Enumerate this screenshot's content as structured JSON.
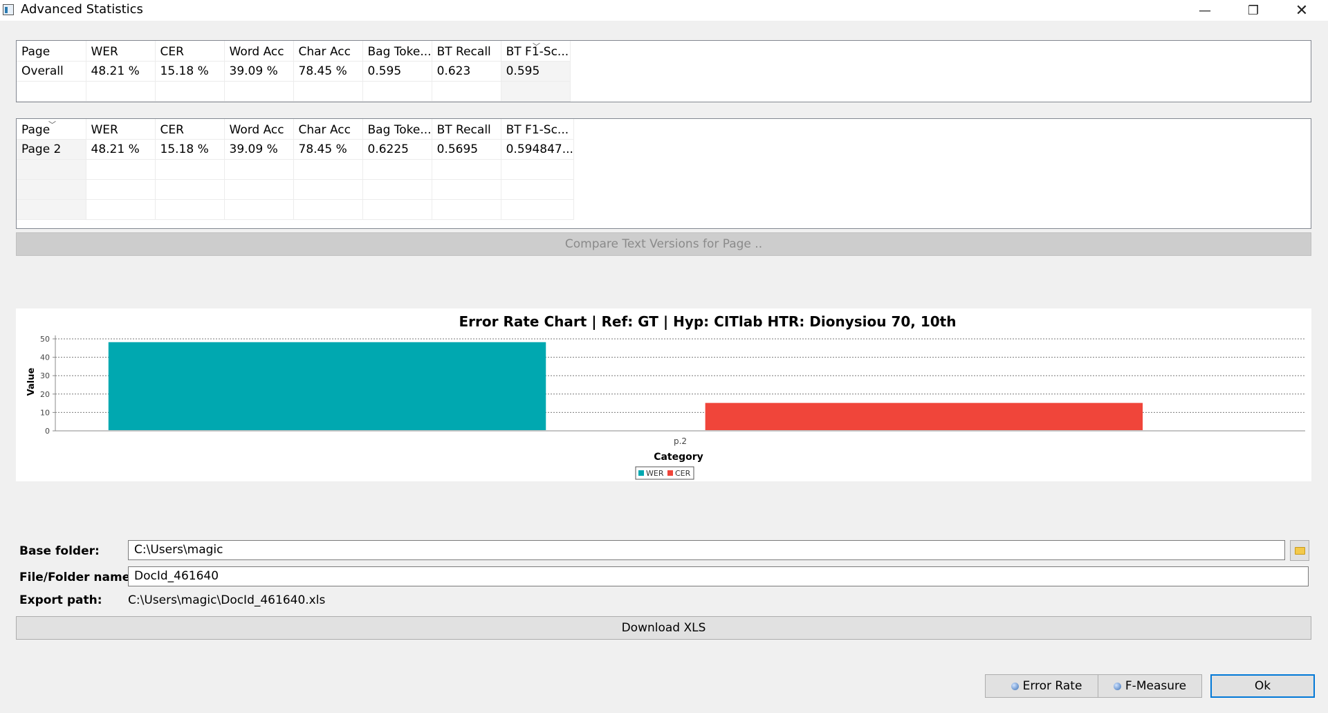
{
  "window": {
    "title": "Advanced Statistics",
    "minimize_symbol": "—",
    "maximize_symbol": "❐",
    "close_symbol": "✕"
  },
  "overall_table": {
    "columns": [
      "Page",
      "WER",
      "CER",
      "Word Acc",
      "Char Acc",
      "Bag Toke...",
      "BT Recall",
      "BT F1-Sc..."
    ],
    "rows": [
      [
        "Overall",
        "48.21 %",
        "15.18 %",
        "39.09 %",
        "78.45 %",
        "0.595",
        "0.623",
        "0.595"
      ]
    ]
  },
  "page_table": {
    "columns": [
      "Page",
      "WER",
      "CER",
      "Word Acc",
      "Char Acc",
      "Bag Toke...",
      "BT Recall",
      "BT F1-Sc..."
    ],
    "rows": [
      [
        "Page 2",
        "48.21 %",
        "15.18 %",
        "39.09 %",
        "78.45 %",
        "0.6225",
        "0.5695",
        "0.594847..."
      ]
    ]
  },
  "compare_button": "Compare Text Versions for Page ..",
  "chart_data": {
    "type": "bar",
    "title": "Error Rate Chart  |  Ref:  GT   |  Hyp: CITlab HTR: Dionysiou 70, 10th",
    "xlabel": "Category",
    "ylabel": "Value",
    "categories": [
      "p.2"
    ],
    "series": [
      {
        "name": "WER",
        "values": [
          48.21
        ],
        "color": "#00a8b0"
      },
      {
        "name": "CER",
        "values": [
          15.18
        ],
        "color": "#f0453a"
      }
    ],
    "ylim": [
      0,
      50
    ],
    "yticks": [
      0,
      10,
      20,
      30,
      40,
      50
    ],
    "grid": true,
    "legend_position": "bottom"
  },
  "export": {
    "base_folder_label": "Base folder:",
    "base_folder_value": "C:\\Users\\magic",
    "file_name_label": "File/Folder name:",
    "file_name_value": "DocId_461640",
    "export_path_label": "Export path:",
    "export_path_value": "C:\\Users\\magic\\DocId_461640.xls",
    "download_button": "Download XLS"
  },
  "buttons": {
    "error_rate": "Error Rate",
    "f_measure": "F-Measure",
    "ok": "Ok"
  }
}
